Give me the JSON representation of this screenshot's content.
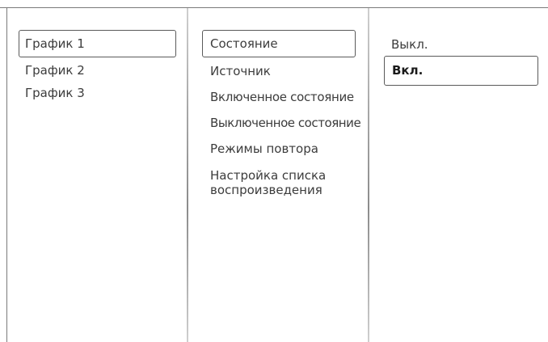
{
  "columns": {
    "schedules": {
      "items": [
        {
          "label": "График 1",
          "selected": true
        },
        {
          "label": "График 2",
          "selected": false
        },
        {
          "label": "График 3",
          "selected": false
        }
      ]
    },
    "settings": {
      "items": [
        {
          "label": "Состояние",
          "selected": true
        },
        {
          "label": "Источник",
          "selected": false
        },
        {
          "label": "Включенное состояние",
          "selected": false
        },
        {
          "label": "Выключенное состояние",
          "selected": false
        },
        {
          "label": "Режимы повтора",
          "selected": false
        },
        {
          "label": "Настройка списка воспроизведения",
          "selected": false
        }
      ]
    },
    "values": {
      "items": [
        {
          "label": "Выкл.",
          "selected": false
        },
        {
          "label": "Вкл.",
          "selected": true
        }
      ]
    }
  },
  "colors": {
    "text": "#3c3c3c",
    "selection_border": "#5a5a5a",
    "frame": "#7a7a7a"
  }
}
